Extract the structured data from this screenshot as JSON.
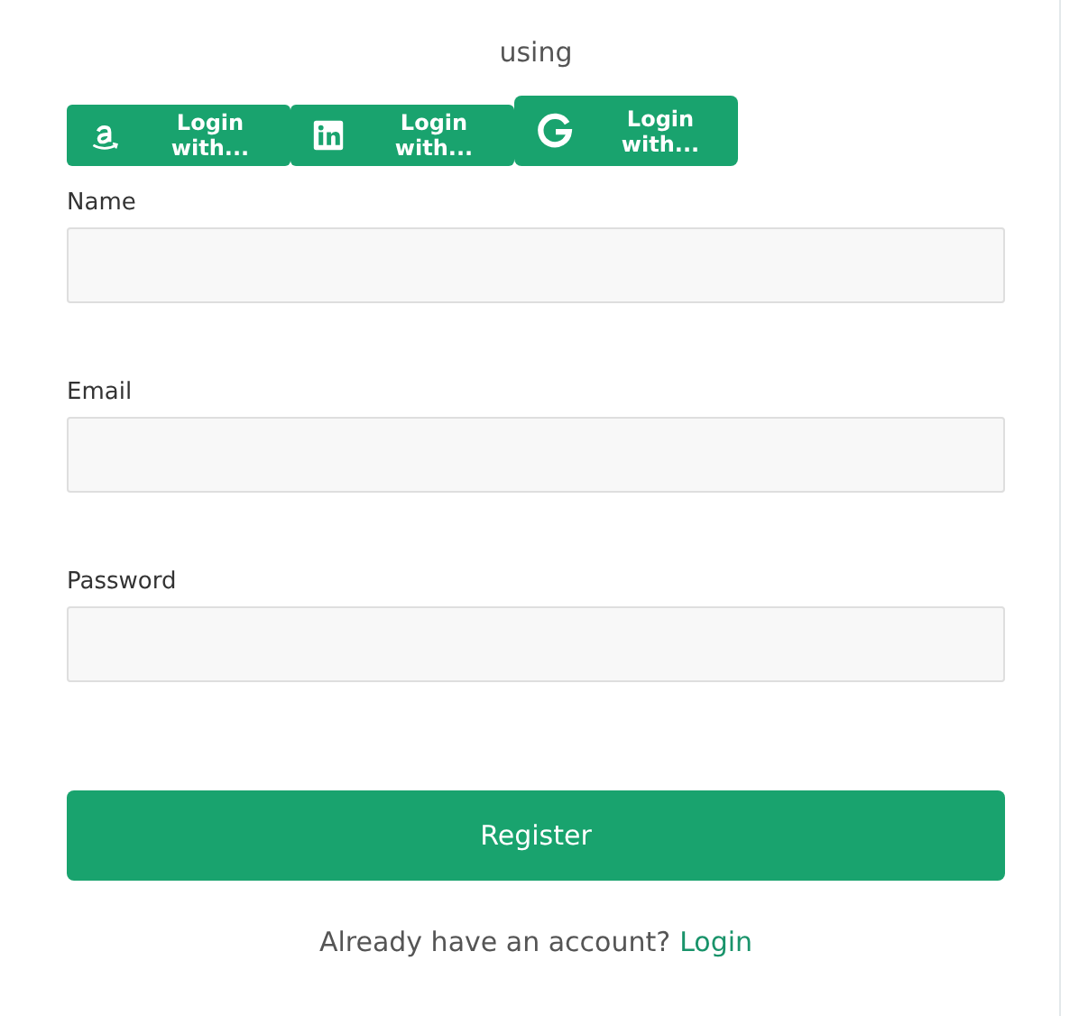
{
  "heading": "using",
  "social_buttons": [
    {
      "kind": "amazon",
      "label": "Login with...",
      "hovered": false
    },
    {
      "kind": "linkedin",
      "label": "Login with...",
      "hovered": false
    },
    {
      "kind": "google",
      "label": "Login with...",
      "hovered": true
    }
  ],
  "fields": [
    {
      "label": "Name"
    },
    {
      "label": "Email"
    },
    {
      "label": "Password"
    }
  ],
  "submit": "Register",
  "footer": {
    "text": "Already have an account?",
    "link": "Login"
  }
}
